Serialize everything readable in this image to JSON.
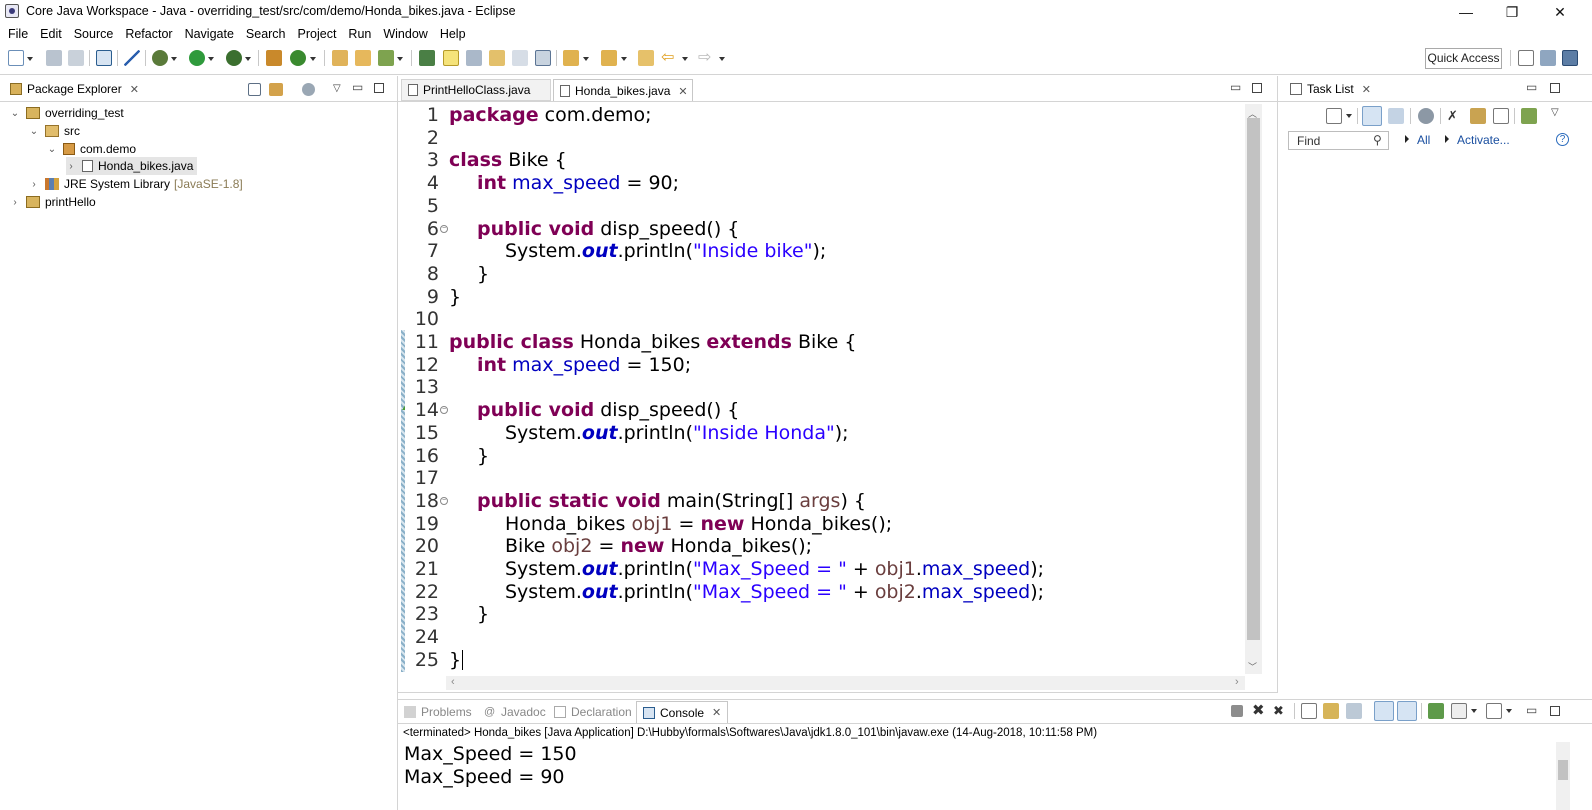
{
  "window": {
    "title": "Core Java Workspace - Java - overriding_test/src/com/demo/Honda_bikes.java - Eclipse",
    "controls": [
      "—",
      "❐",
      "✕"
    ]
  },
  "menu": [
    "File",
    "Edit",
    "Source",
    "Refactor",
    "Navigate",
    "Search",
    "Project",
    "Run",
    "Window",
    "Help"
  ],
  "toolbar": {
    "quick_access": "Quick Access"
  },
  "package_explorer": {
    "title": "Package Explorer",
    "tree": [
      {
        "label": "overriding_test",
        "expanded": true,
        "icon": "project-icon"
      },
      {
        "label": "src",
        "expanded": true,
        "icon": "source-folder-icon"
      },
      {
        "label": "com.demo",
        "expanded": true,
        "icon": "package-icon"
      },
      {
        "label": "Honda_bikes.java",
        "expanded": false,
        "icon": "java-file-icon"
      },
      {
        "label": "JRE System Library",
        "suffix": "[JavaSE-1.8]",
        "expanded": false,
        "icon": "library-icon"
      },
      {
        "label": "printHello",
        "expanded": false,
        "icon": "project-icon"
      }
    ]
  },
  "editor": {
    "tabs": [
      {
        "label": "PrintHelloClass.java",
        "active": false
      },
      {
        "label": "Honda_bikes.java",
        "active": true
      }
    ],
    "line_numbers": [
      "1",
      "2",
      "3",
      "4",
      "5",
      "6",
      "7",
      "8",
      "9",
      "10",
      "11",
      "12",
      "13",
      "14",
      "15",
      "16",
      "17",
      "18",
      "19",
      "20",
      "21",
      "22",
      "23",
      "24",
      "25"
    ],
    "code": {
      "l1_kw": "package",
      "l1_rest": " com.demo;",
      "l3_kw": "class",
      "l3_rest": " Bike {",
      "l4_kw": "int",
      "l4_field": "max_speed",
      "l4_rest": " = 90;",
      "l6_kw": "public void",
      "l6_rest": " disp_speed() {",
      "l7_a": "System.",
      "l7_out": "out",
      "l7_b": ".println(",
      "l7_str": "\"Inside bike\"",
      "l7_c": ");",
      "l8": "}",
      "l9": "}",
      "l11_kw1": "public class",
      "l11_mid": " Honda_bikes ",
      "l11_kw2": "extends",
      "l11_rest": " Bike {",
      "l12_kw": "int",
      "l12_field": "max_speed",
      "l12_rest": " = 150;",
      "l14_kw": "public void",
      "l14_rest": " disp_speed() {",
      "l15_a": "System.",
      "l15_out": "out",
      "l15_b": ".println(",
      "l15_str": "\"Inside Honda\"",
      "l15_c": ");",
      "l16": "}",
      "l18_kw": "public static void",
      "l18_mid": " main(String[] ",
      "l18_var": "args",
      "l18_rest": ") {",
      "l19_a": "Honda_bikes ",
      "l19_var": "obj1",
      "l19_b": " = ",
      "l19_kw": "new",
      "l19_c": " Honda_bikes();",
      "l20_a": "Bike ",
      "l20_var": "obj2",
      "l20_b": " = ",
      "l20_kw": "new",
      "l20_c": " Honda_bikes();",
      "l21_a": "System.",
      "l21_out": "out",
      "l21_b": ".println(",
      "l21_str": "\"Max_Speed = \"",
      "l21_c": " + ",
      "l21_var": "obj1",
      "l21_d": ".",
      "l21_field": "max_speed",
      "l21_e": ");",
      "l22_a": "System.",
      "l22_out": "out",
      "l22_b": ".println(",
      "l22_str": "\"Max_Speed = \"",
      "l22_c": " + ",
      "l22_var": "obj2",
      "l22_d": ".",
      "l22_field": "max_speed",
      "l22_e": ");",
      "l23": "}",
      "l25": "}"
    }
  },
  "task_list": {
    "title": "Task List",
    "find_placeholder": "Find",
    "all_label": "All",
    "activate_label": "Activate..."
  },
  "bottom_panel": {
    "tabs": [
      {
        "label": "Problems",
        "active": false
      },
      {
        "label": "Javadoc",
        "active": false
      },
      {
        "label": "Declaration",
        "active": false
      },
      {
        "label": "Console",
        "active": true
      }
    ],
    "terminated": "<terminated> Honda_bikes [Java Application] D:\\Hubby\\formals\\Softwares\\Java\\jdk1.8.0_101\\bin\\javaw.exe (14-Aug-2018, 10:11:58 PM)",
    "output": [
      "Max_Speed = 150",
      "Max_Speed = 90"
    ]
  },
  "colors": {
    "keyword": "#7f0055",
    "field": "#0000c0",
    "string": "#2a00ff",
    "local_var": "#6a3e3e",
    "current_line": "#e8f2fe"
  }
}
